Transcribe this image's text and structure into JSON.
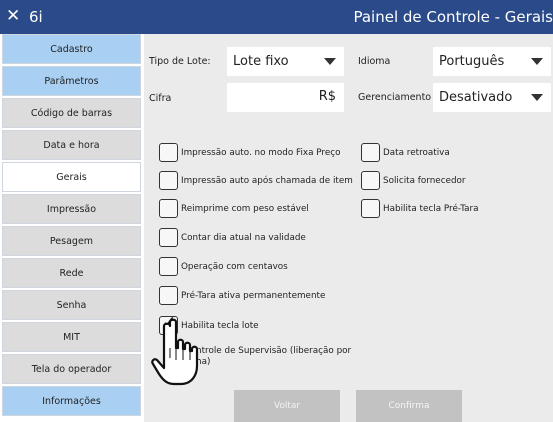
{
  "titlebar": {
    "close_glyph": "✕",
    "app_name": "6i",
    "title": "Painel de Controle - Gerais",
    "bg_color": "#2a4a8a"
  },
  "sidebar": {
    "items": [
      {
        "label": "Cadastro",
        "style": "blue"
      },
      {
        "label": "Parâmetros",
        "style": "blue"
      },
      {
        "label": "Código de barras",
        "style": "gray"
      },
      {
        "label": "Data e hora",
        "style": "gray"
      },
      {
        "label": "Gerais",
        "style": "active"
      },
      {
        "label": "Impressão",
        "style": "gray"
      },
      {
        "label": "Pesagem",
        "style": "gray"
      },
      {
        "label": "Rede",
        "style": "gray"
      },
      {
        "label": "Senha",
        "style": "gray"
      },
      {
        "label": "MIT",
        "style": "gray"
      },
      {
        "label": "Tela do operador",
        "style": "gray"
      },
      {
        "label": "Informações",
        "style": "blue"
      }
    ]
  },
  "form": {
    "tipo_lote": {
      "label": "Tipo de Lote:",
      "value": "Lote fixo"
    },
    "idioma": {
      "label": "Idioma",
      "value": "Português"
    },
    "cifra": {
      "label": "Cifra",
      "value": "R$"
    },
    "gerenciamento": {
      "label": "Gerenciamento",
      "value": "Desativado"
    }
  },
  "checkboxes": {
    "left": [
      {
        "label": "Impressão auto. no modo Fixa Preço",
        "checked": false
      },
      {
        "label": "Impressão auto após chamada de item",
        "checked": false
      },
      {
        "label": "Reimprime com peso estável",
        "checked": false
      },
      {
        "label": "Contar dia atual na validade",
        "checked": false
      },
      {
        "label": "Operação com centavos",
        "checked": false
      },
      {
        "label": "Pré-Tara ativa permanentemente",
        "checked": false
      },
      {
        "label": "Habilita tecla lote",
        "checked": true
      },
      {
        "label": "ntrole de Supervisão (liberação por",
        "label2": "ha)",
        "checked": false
      }
    ],
    "right": [
      {
        "label": "Data retroativa",
        "checked": false
      },
      {
        "label": "Solicita fornecedor",
        "checked": false
      },
      {
        "label": "Habilita tecla Pré-Tara",
        "checked": false
      }
    ]
  },
  "buttons": {
    "back": "Voltar",
    "confirm": "Confirma"
  },
  "icons": {
    "checkmark": "✓",
    "cursor": "hand-pointer-icon"
  }
}
